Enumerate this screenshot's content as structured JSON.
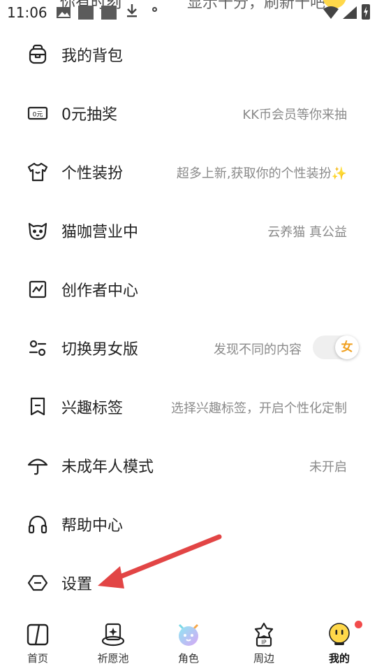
{
  "status_bar": {
    "time": "11:06",
    "overlay_left": "你有时刻",
    "overlay_right": "显示十分，刷新十吧"
  },
  "menu": {
    "items": [
      {
        "label": "我的背包",
        "hint": "",
        "icon": "backpack-icon"
      },
      {
        "label": "0元抽奖",
        "hint": "KK币会员等你来抽",
        "icon": "zero-yuan-ticket-icon"
      },
      {
        "label": "个性装扮",
        "hint": "超多上新,获取你的个性装扮✨",
        "icon": "tshirt-icon"
      },
      {
        "label": "猫咖营业中",
        "hint": "云养猫 真公益",
        "icon": "cat-face-icon"
      },
      {
        "label": "创作者中心",
        "hint": "",
        "icon": "chart-frame-icon"
      },
      {
        "label": "切换男女版",
        "hint": "发现不同的内容",
        "icon": "switch-icon",
        "toggle_label": "女"
      },
      {
        "label": "兴趣标签",
        "hint": "选择兴趣标签，开启个性化定制",
        "icon": "bookmark-icon"
      },
      {
        "label": "未成年人模式",
        "hint": "未开启",
        "icon": "umbrella-icon"
      },
      {
        "label": "帮助中心",
        "hint": "",
        "icon": "headphones-icon"
      },
      {
        "label": "设置",
        "hint": "",
        "icon": "settings-hexagon-icon"
      }
    ]
  },
  "tabbar": {
    "tabs": [
      {
        "label": "首页",
        "icon": "home-book-icon",
        "active": false
      },
      {
        "label": "祈愿池",
        "icon": "wishing-well-icon",
        "active": false
      },
      {
        "label": "角色",
        "icon": "character-icon",
        "active": false
      },
      {
        "label": "周边",
        "icon": "ip-merch-icon",
        "active": false
      },
      {
        "label": "我的",
        "icon": "my-face-icon",
        "active": true
      }
    ]
  },
  "colors": {
    "accent_toggle": "#f0a020",
    "arrow": "#e24545",
    "hint_text": "#8a8a8a",
    "badge": "#f24b4b"
  }
}
